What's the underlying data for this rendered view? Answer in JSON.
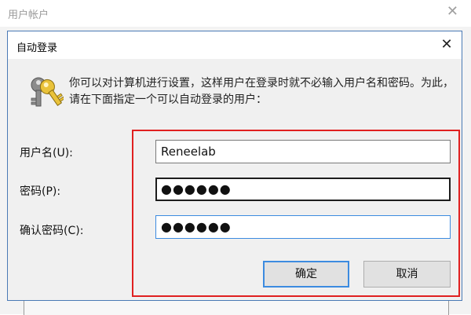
{
  "background_window": {
    "title": "用户帐户",
    "close_glyph": "✕"
  },
  "dialog": {
    "title": "自动登录",
    "close_glyph": "✕",
    "icon": "keys-icon",
    "description": "你可以对计算机进行设置，这样用户在登录时就不必输入用户名和密码。为此，请在下面指定一个可以自动登录的用户：",
    "fields": {
      "username_label": "用户名(U):",
      "username_value": "Reneelab",
      "password_label": "密码(P):",
      "password_value": "●●●●●●",
      "confirm_label": "确认密码(C):",
      "confirm_value": "●●●●●●"
    },
    "buttons": {
      "ok_label": "确定",
      "cancel_label": "取消"
    }
  },
  "colors": {
    "highlight_border": "#e02020",
    "focus_blue": "#3c8be0",
    "dialog_bg": "#f0f0f0"
  }
}
